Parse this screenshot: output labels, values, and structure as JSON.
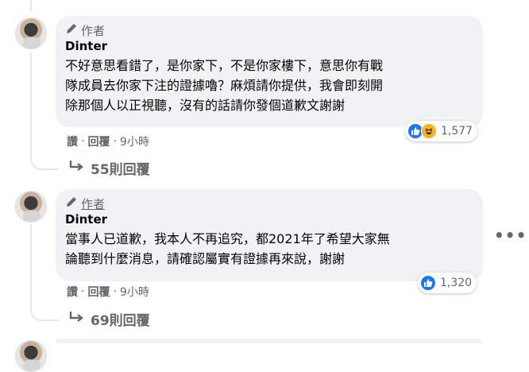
{
  "comments": [
    {
      "badge": "作者",
      "name": "Dinter",
      "text_lines": [
        "不好意思看錯了，是你家下，不是你家樓下，意思你有戰",
        "隊成員去你家下注的證據嚕？麻煩請你提供，我會即刻開",
        "除那個人以正視聽，沒有的話請你發個道歉文謝謝"
      ],
      "actions": {
        "like": "讚",
        "reply": "回覆",
        "time": "9小時"
      },
      "reactions": {
        "icons": [
          "like-icon",
          "haha-icon"
        ],
        "count": "1,577"
      },
      "replies_label": "55則回覆"
    },
    {
      "badge": "作者",
      "name": "Dinter",
      "text_lines": [
        "當事人已道歉，我本人不再追究，都2021年了希望大家無",
        "論聽到什麼消息，請確認屬實有證據再來說，謝謝"
      ],
      "actions": {
        "like": "讚",
        "reply": "回覆",
        "time": "9小時"
      },
      "reactions": {
        "icons": [
          "like-icon"
        ],
        "count": "1,320"
      },
      "replies_label": "69則回覆"
    }
  ],
  "more_options": "•••",
  "colors": {
    "bubble": "#f0f2f5",
    "like_blue": "#1877f2",
    "haha_yellow": "#f7b125",
    "muted": "#65676b"
  }
}
